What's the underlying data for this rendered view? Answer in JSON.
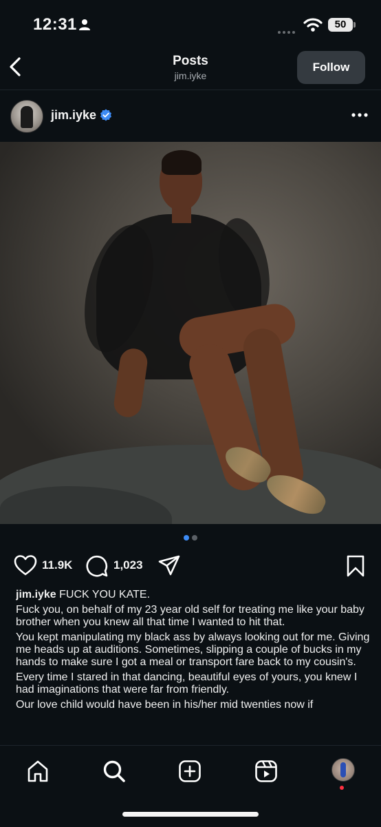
{
  "status_bar": {
    "time": "12:31",
    "battery": "50"
  },
  "top_bar": {
    "title": "Posts",
    "subtitle": "jim.iyke",
    "follow_label": "Follow"
  },
  "post": {
    "username": "jim.iyke",
    "image_count": 2,
    "active_image": 1,
    "likes": "11.9K",
    "comments": "1,023",
    "caption": {
      "username": "jim.iyke",
      "headline": "FUCK YOU KATE.",
      "paragraphs": [
        "Fuck you, on behalf of my 23 year old self for treating me like your baby brother when you knew all that time I wanted to hit that.",
        "You kept manipulating my black ass by always looking out for me. Giving me heads up at auditions. Sometimes, slipping a couple of bucks in my hands to make sure I got a meal or transport fare back to my cousin's.",
        "Every time I stared in that dancing, beautiful eyes of yours, you knew I had imaginations that were far from friendly.",
        "Our love child would have been in his/her mid twenties now if"
      ]
    }
  },
  "icons": {
    "back": "chevron-left-icon",
    "verified": "verified-badge-icon",
    "more": "more-horizontal-icon",
    "like": "heart-icon",
    "comment": "comment-icon",
    "share": "send-icon",
    "save": "bookmark-icon",
    "home": "home-icon",
    "search": "search-icon",
    "create": "create-plus-icon",
    "reels": "reels-icon"
  },
  "colors": {
    "background": "#0b1014",
    "accent_blue": "#3d8bf5",
    "follow_button": "#343a40",
    "notification": "#ff3040"
  }
}
